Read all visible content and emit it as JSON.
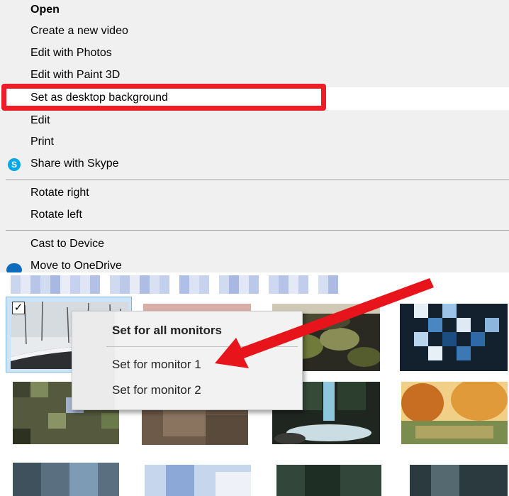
{
  "context_menu": {
    "items": [
      {
        "label": "Open"
      },
      {
        "label": "Create a new video"
      },
      {
        "label": "Edit with Photos"
      },
      {
        "label": "Edit with Paint 3D"
      },
      {
        "label": "Set as desktop background"
      },
      {
        "label": "Edit"
      },
      {
        "label": "Print"
      },
      {
        "label": "Share with Skype",
        "icon": "skype-icon"
      },
      {
        "label": "Rotate right"
      },
      {
        "label": "Rotate left"
      },
      {
        "label": "Cast to Device"
      },
      {
        "label": "Move to OneDrive",
        "icon": "onedrive-icon"
      }
    ],
    "highlight_color": "#ee1c25"
  },
  "submenu": {
    "items": [
      {
        "label": "Set for all monitors"
      },
      {
        "label": "Set for monitor 1"
      },
      {
        "label": "Set for monitor 2"
      }
    ]
  },
  "thumbnail_grid": {
    "selected_checkbox": "✓"
  },
  "colors": {
    "menu_bg": "#f0f0f0",
    "arrow": "#e8141c",
    "selection": "#cce4f7"
  }
}
